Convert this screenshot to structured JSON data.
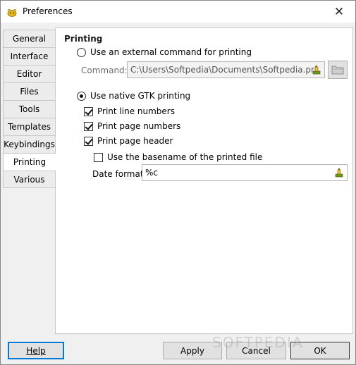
{
  "window": {
    "title": "Preferences",
    "close_glyph": "✕"
  },
  "tabs": [
    {
      "label": "General"
    },
    {
      "label": "Interface"
    },
    {
      "label": "Editor"
    },
    {
      "label": "Files"
    },
    {
      "label": "Tools"
    },
    {
      "label": "Templates"
    },
    {
      "label": "Keybindings"
    },
    {
      "label": "Printing",
      "active": true
    },
    {
      "label": "Various"
    }
  ],
  "printing": {
    "heading": "Printing",
    "external_command_label": "Use an external command for printing",
    "external_command_selected": false,
    "command_label": "Command:",
    "command_value": "C:\\Users\\Softpedia\\Documents\\Softpedia.prj",
    "native_gtk_label": "Use native GTK printing",
    "native_gtk_selected": true,
    "print_line_numbers_label": "Print line numbers",
    "print_line_numbers_checked": true,
    "print_page_numbers_label": "Print page numbers",
    "print_page_numbers_checked": true,
    "print_page_header_label": "Print page header",
    "print_page_header_checked": true,
    "use_basename_label": "Use the basename of the printed file",
    "use_basename_checked": false,
    "date_format_label": "Date format:",
    "date_format_value": "%c"
  },
  "buttons": {
    "help": "Help",
    "apply": "Apply",
    "cancel": "Cancel",
    "ok": "OK"
  },
  "watermark": "SOFTPEDIA",
  "icons": {
    "app": "geany-teapot-icon",
    "clear": "clear-field-icon",
    "folder": "folder-icon"
  }
}
